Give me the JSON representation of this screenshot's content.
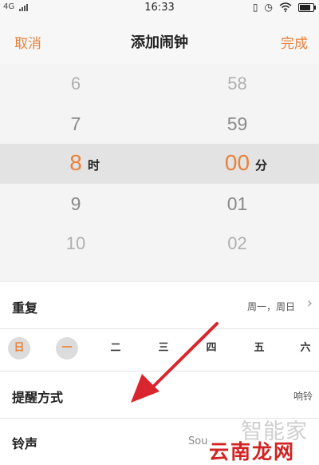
{
  "status_bar": {
    "carrier": "4G",
    "time": "16:33",
    "icons": [
      "vibrate-icon",
      "alarm-icon",
      "wifi-icon",
      "battery-icon"
    ]
  },
  "nav": {
    "cancel_label": "取消",
    "title": "添加闹钟",
    "done_label": "完成"
  },
  "picker": {
    "hours": [
      "6",
      "7",
      "8",
      "9",
      "10"
    ],
    "minutes": [
      "58",
      "59",
      "00",
      "01",
      "02"
    ],
    "selected_hour": "8",
    "selected_minute": "00",
    "hour_unit": "时",
    "minute_unit": "分"
  },
  "settings": {
    "repeat_label": "重复",
    "repeat_value": "周一，周日",
    "days": [
      {
        "label": "日",
        "selected": true
      },
      {
        "label": "一",
        "selected": true
      },
      {
        "label": "二",
        "selected": false
      },
      {
        "label": "三",
        "selected": false
      },
      {
        "label": "四",
        "selected": false
      },
      {
        "label": "五",
        "selected": false
      },
      {
        "label": "六",
        "selected": false
      }
    ],
    "remind_label": "提醒方式",
    "remind_value": "响铃",
    "ringtone_label": "铃声",
    "ringtone_value": "Sou"
  },
  "watermark": {
    "top_text": "智能家",
    "bottom_text": "云南龙网"
  },
  "colors": {
    "accent": "#e8823a",
    "arrow": "#d9262e"
  }
}
